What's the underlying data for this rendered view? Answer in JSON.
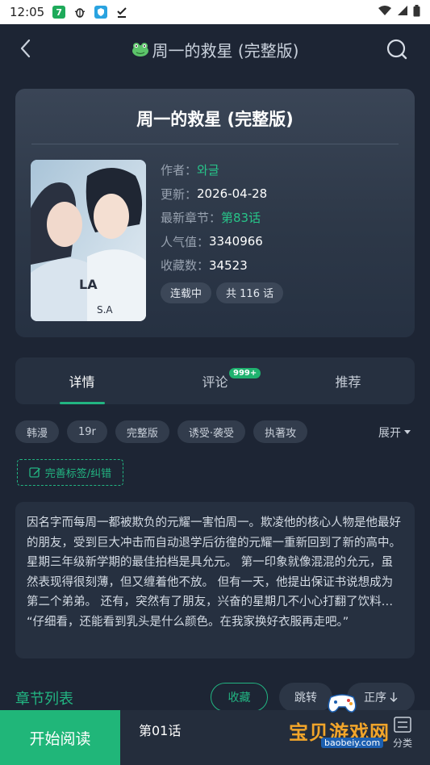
{
  "status_bar": {
    "time": "12:05",
    "icons": [
      "seven-app-icon",
      "insect-icon",
      "shield-app-icon",
      "download-check-icon",
      "wifi-icon",
      "signal-icon",
      "battery-icon"
    ]
  },
  "header": {
    "title": "周一的救星 (完整版)"
  },
  "comic": {
    "title": "周一的救星 (完整版)",
    "author_label": "作者：",
    "author": "와글",
    "updated_label": "更新：",
    "updated": "2026-04-28",
    "latest_label": "最新章节：",
    "latest": "第83话",
    "popularity_label": "人气值：",
    "popularity": "3340966",
    "favorites_label": "收藏数：",
    "favorites": "34523",
    "status_badge": "连载中",
    "total_badge": "共 116 话"
  },
  "tabs": [
    {
      "label": "详情",
      "active": true
    },
    {
      "label": "评论",
      "badge": "999+"
    },
    {
      "label": "推荐"
    }
  ],
  "tags": [
    "韩漫",
    "19r",
    "完整版",
    "诱受·袭受",
    "执著攻"
  ],
  "expand_label": "展开",
  "edit_tags_label": "完善标签/纠错",
  "description": "因名字而每周一都被欺负的元耀一害怕周一。欺凌他的核心人物是他最好的朋友，受到巨大冲击而自动退学后彷徨的元耀一重新回到了新的高中。 星期三年级新学期的最佳拍档是具允元。 第一印象就像混混的允元，虽然表现得很刻薄，但又缠着他不放。 但有一天，他提出保证书说想成为第二个弟弟。 还有，突然有了朋友，兴奋的星期几不小心打翻了饮料… “仔细看，还能看到乳头是什么颜色。在我家换好衣服再走吧。”",
  "chapters": {
    "title": "章节列表",
    "favorite_label": "收藏",
    "jump_label": "跳转",
    "order_label": "正序"
  },
  "bottom": {
    "start_label": "开始阅读",
    "chapter_label": "第01话",
    "category_label": "分类"
  },
  "watermark": {
    "text": "宝贝游戏网",
    "url": "baobeiy.com"
  },
  "colors": {
    "accent": "#22b582",
    "background": "#1d2534",
    "card": "#263040"
  }
}
